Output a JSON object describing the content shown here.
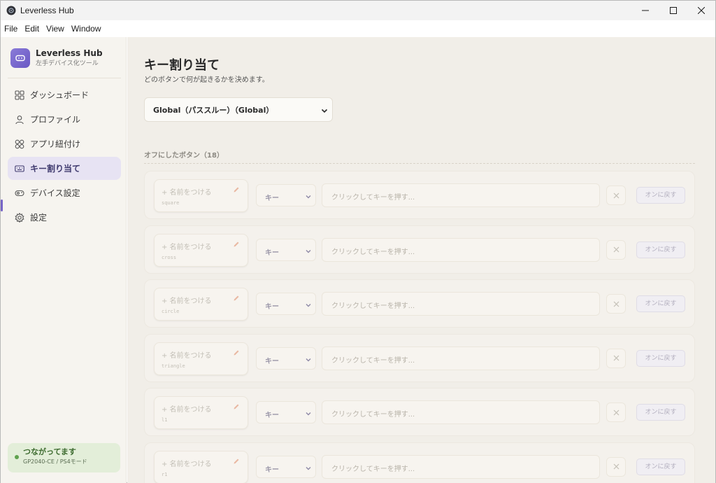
{
  "window": {
    "title": "Leverless Hub",
    "controls": [
      "minimize-icon",
      "maximize-icon",
      "close-icon"
    ]
  },
  "menu": [
    "File",
    "Edit",
    "View",
    "Window"
  ],
  "sidebar": {
    "brand_name": "Leverless Hub",
    "brand_sub": "左手デバイス化ツール",
    "items": [
      {
        "label": "ダッシュボード",
        "icon": "grid-icon",
        "active": false
      },
      {
        "label": "プロファイル",
        "icon": "user-icon",
        "active": false
      },
      {
        "label": "アプリ紐付け",
        "icon": "apps-icon",
        "active": false
      },
      {
        "label": "キー割り当て",
        "icon": "keyboard-icon",
        "active": true
      },
      {
        "label": "デバイス設定",
        "icon": "gamepad-icon",
        "active": false
      },
      {
        "label": "設定",
        "icon": "gear-icon",
        "active": false
      }
    ],
    "status": {
      "title": "つながってます",
      "subtitle": "GP2040-CE / PS4モード",
      "color": "#5fa24e"
    }
  },
  "main": {
    "title": "キー割り当て",
    "subtitle": "どのボタンで何が起きるかを決めます。",
    "profile_select": "Global（パススルー）（Global）",
    "section_label": "オフにしたボタン（18）",
    "rows": [
      {
        "name_label": "+ 名前をつける",
        "button_id": "square",
        "type": "キー",
        "key_placeholder": "クリックしてキーを押す...",
        "restore": "オンに戻す"
      },
      {
        "name_label": "+ 名前をつける",
        "button_id": "cross",
        "type": "キー",
        "key_placeholder": "クリックしてキーを押す...",
        "restore": "オンに戻す"
      },
      {
        "name_label": "+ 名前をつける",
        "button_id": "circle",
        "type": "キー",
        "key_placeholder": "クリックしてキーを押す...",
        "restore": "オンに戻す"
      },
      {
        "name_label": "+ 名前をつける",
        "button_id": "triangle",
        "type": "キー",
        "key_placeholder": "クリックしてキーを押す...",
        "restore": "オンに戻す"
      },
      {
        "name_label": "+ 名前をつける",
        "button_id": "l1",
        "type": "キー",
        "key_placeholder": "クリックしてキーを押す...",
        "restore": "オンに戻す"
      },
      {
        "name_label": "+ 名前をつける",
        "button_id": "r1",
        "type": "キー",
        "key_placeholder": "クリックしてキーを押す...",
        "restore": "オンに戻す"
      }
    ]
  },
  "colors": {
    "accent": "#7664c7",
    "sidebar_bg": "#f6f4ef",
    "main_bg": "#f1eee8"
  }
}
